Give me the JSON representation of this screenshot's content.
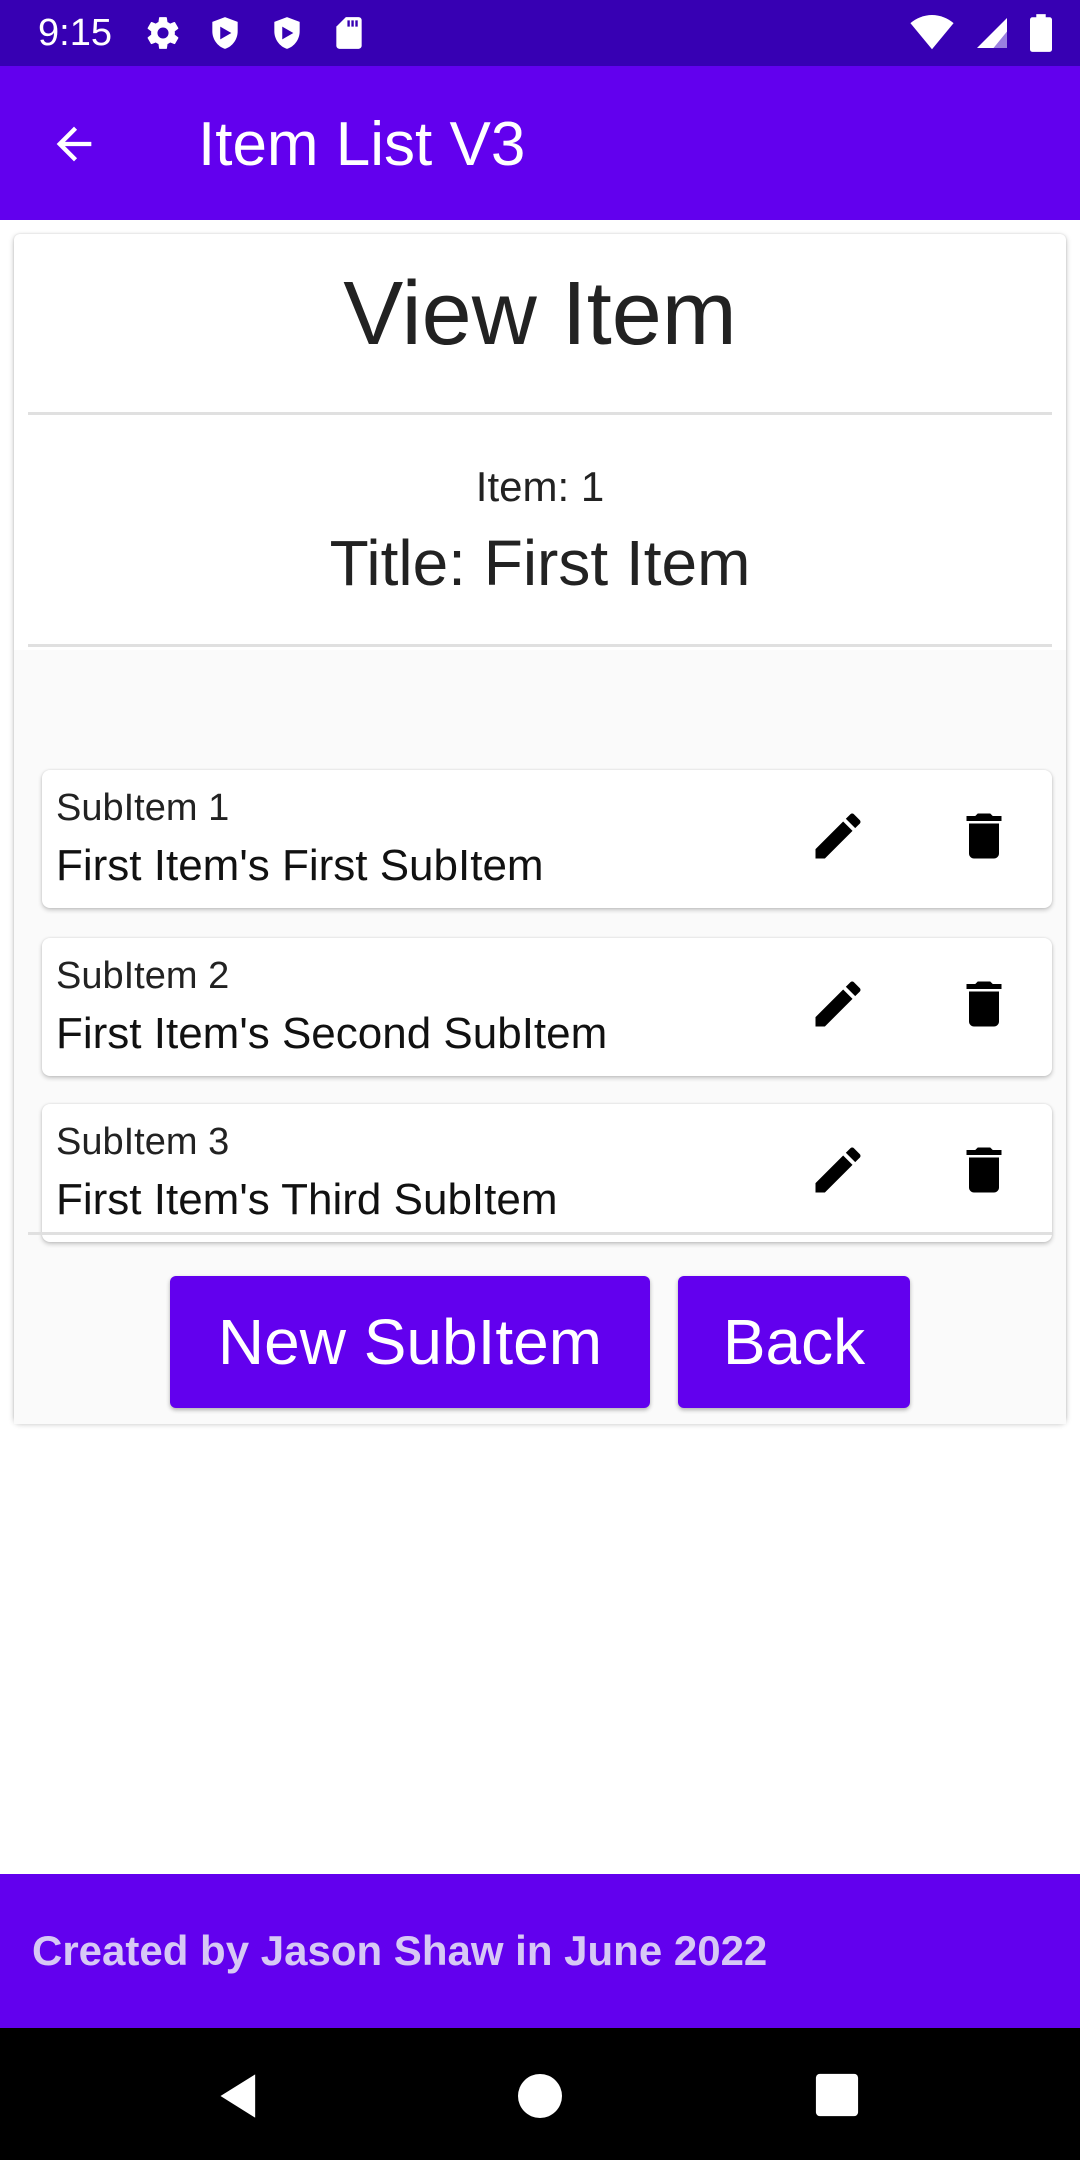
{
  "status_bar": {
    "time": "9:15",
    "left_icons": [
      "settings-icon",
      "shield-icon",
      "shield-icon",
      "sd-card-icon"
    ],
    "right_icons": [
      "wifi-icon",
      "signal-icon",
      "battery-icon"
    ]
  },
  "app_bar": {
    "title": "Item List V3",
    "back_icon": "arrow-back-icon",
    "color": "#6200ee"
  },
  "card": {
    "heading": "View Item",
    "item_number": "Item: 1",
    "item_title": "Title: First Item"
  },
  "subitems": [
    {
      "label": "SubItem 1",
      "description": "First Item's First SubItem"
    },
    {
      "label": "SubItem 2",
      "description": "First Item's Second SubItem"
    },
    {
      "label": "SubItem 3",
      "description": "First Item's Third SubItem"
    }
  ],
  "buttons": {
    "new_subitem": "New SubItem",
    "back": "Back"
  },
  "footer": {
    "text": "Created by Jason Shaw in June 2022"
  },
  "colors": {
    "primary": "#6200ee",
    "primary_dark": "#3700b3",
    "footer_text": "#d7c8f5"
  }
}
